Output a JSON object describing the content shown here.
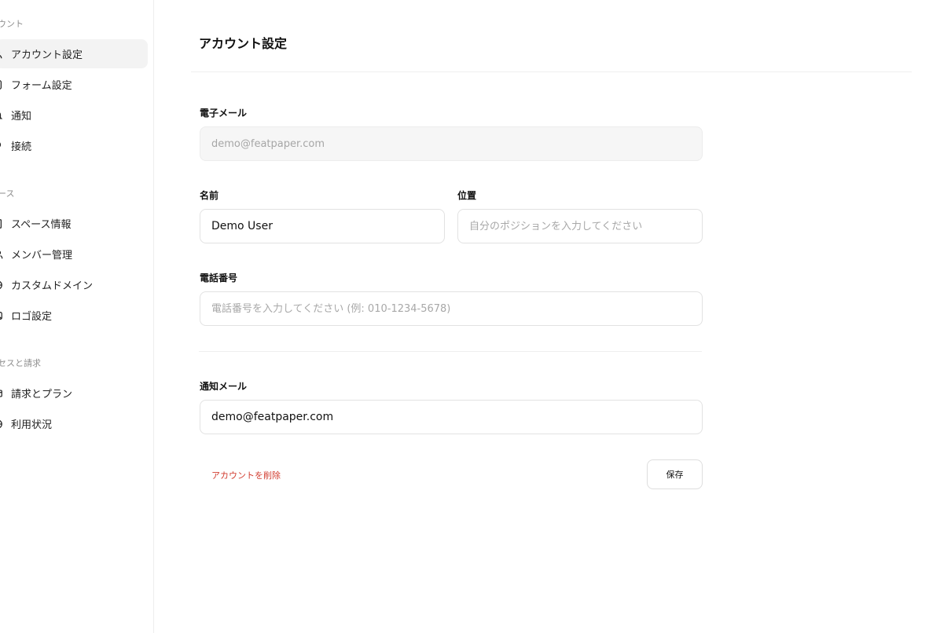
{
  "sidebar": {
    "sections": [
      {
        "title": "カウント",
        "items": [
          {
            "label": "アカウント設定",
            "icon": "user-icon",
            "active": true
          },
          {
            "label": "フォーム設定",
            "icon": "document-icon"
          },
          {
            "label": "通知",
            "icon": "bell-icon"
          },
          {
            "label": "接続",
            "icon": "link-icon"
          }
        ]
      },
      {
        "title": "ペース",
        "items": [
          {
            "label": "スペース情報",
            "icon": "building-icon"
          },
          {
            "label": "メンバー管理",
            "icon": "users-icon"
          },
          {
            "label": "カスタムドメイン",
            "icon": "globe-icon"
          },
          {
            "label": "ロゴ設定",
            "icon": "image-icon"
          }
        ]
      },
      {
        "title": "クセスと請求",
        "items": [
          {
            "label": "請求とプラン",
            "icon": "credit-card-icon"
          },
          {
            "label": "利用状況",
            "icon": "chart-icon"
          }
        ]
      }
    ]
  },
  "main": {
    "title": "アカウント設定",
    "email": {
      "label": "電子メール",
      "placeholder": "demo@featpaper.com",
      "disabled": true
    },
    "name": {
      "label": "名前",
      "value": "Demo User"
    },
    "position": {
      "label": "位置",
      "placeholder": "自分のポジションを入力してください"
    },
    "phone": {
      "label": "電話番号",
      "placeholder": "電話番号を入力してください (例: 010-1234-5678)"
    },
    "notification_email": {
      "label": "通知メール",
      "value": "demo@featpaper.com"
    },
    "delete_label": "アカウントを削除",
    "save_label": "保存"
  },
  "colors": {
    "danger": "#d13b2e",
    "active_bg": "#f3f3f3"
  }
}
